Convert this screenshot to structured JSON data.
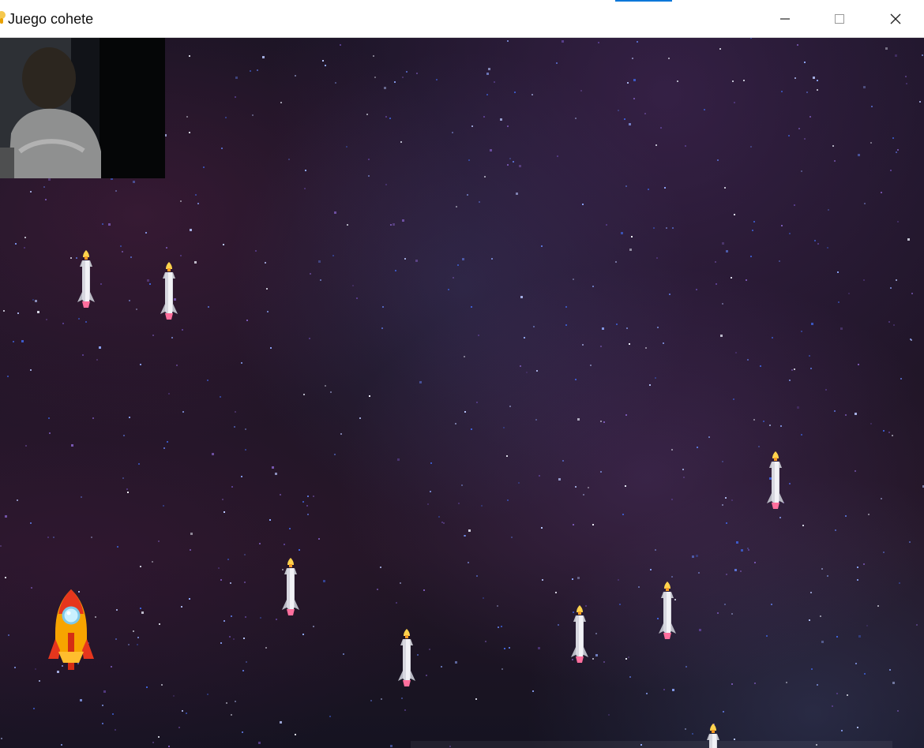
{
  "window": {
    "title": "Juego cohete"
  },
  "webcam": {
    "icon": "webcam-preview"
  },
  "player": {
    "icon": "rocket-icon"
  },
  "missiles": [
    {
      "id": "missile-1",
      "icon": "missile-icon"
    },
    {
      "id": "missile-2",
      "icon": "missile-icon"
    },
    {
      "id": "missile-3",
      "icon": "missile-icon"
    },
    {
      "id": "missile-4",
      "icon": "missile-icon"
    },
    {
      "id": "missile-5",
      "icon": "missile-icon"
    },
    {
      "id": "missile-6",
      "icon": "missile-icon"
    },
    {
      "id": "missile-7",
      "icon": "missile-icon"
    },
    {
      "id": "missile-8",
      "icon": "missile-icon"
    }
  ],
  "colors": {
    "space_dark": "#120d1c",
    "nebula_purple": "#6c4491",
    "nebula_blue": "#4e5b99",
    "rocket_orange": "#f7a400",
    "rocket_red": "#e6361d",
    "missile_silver": "#d7d7df",
    "flame_yellow": "#ffd34d"
  }
}
